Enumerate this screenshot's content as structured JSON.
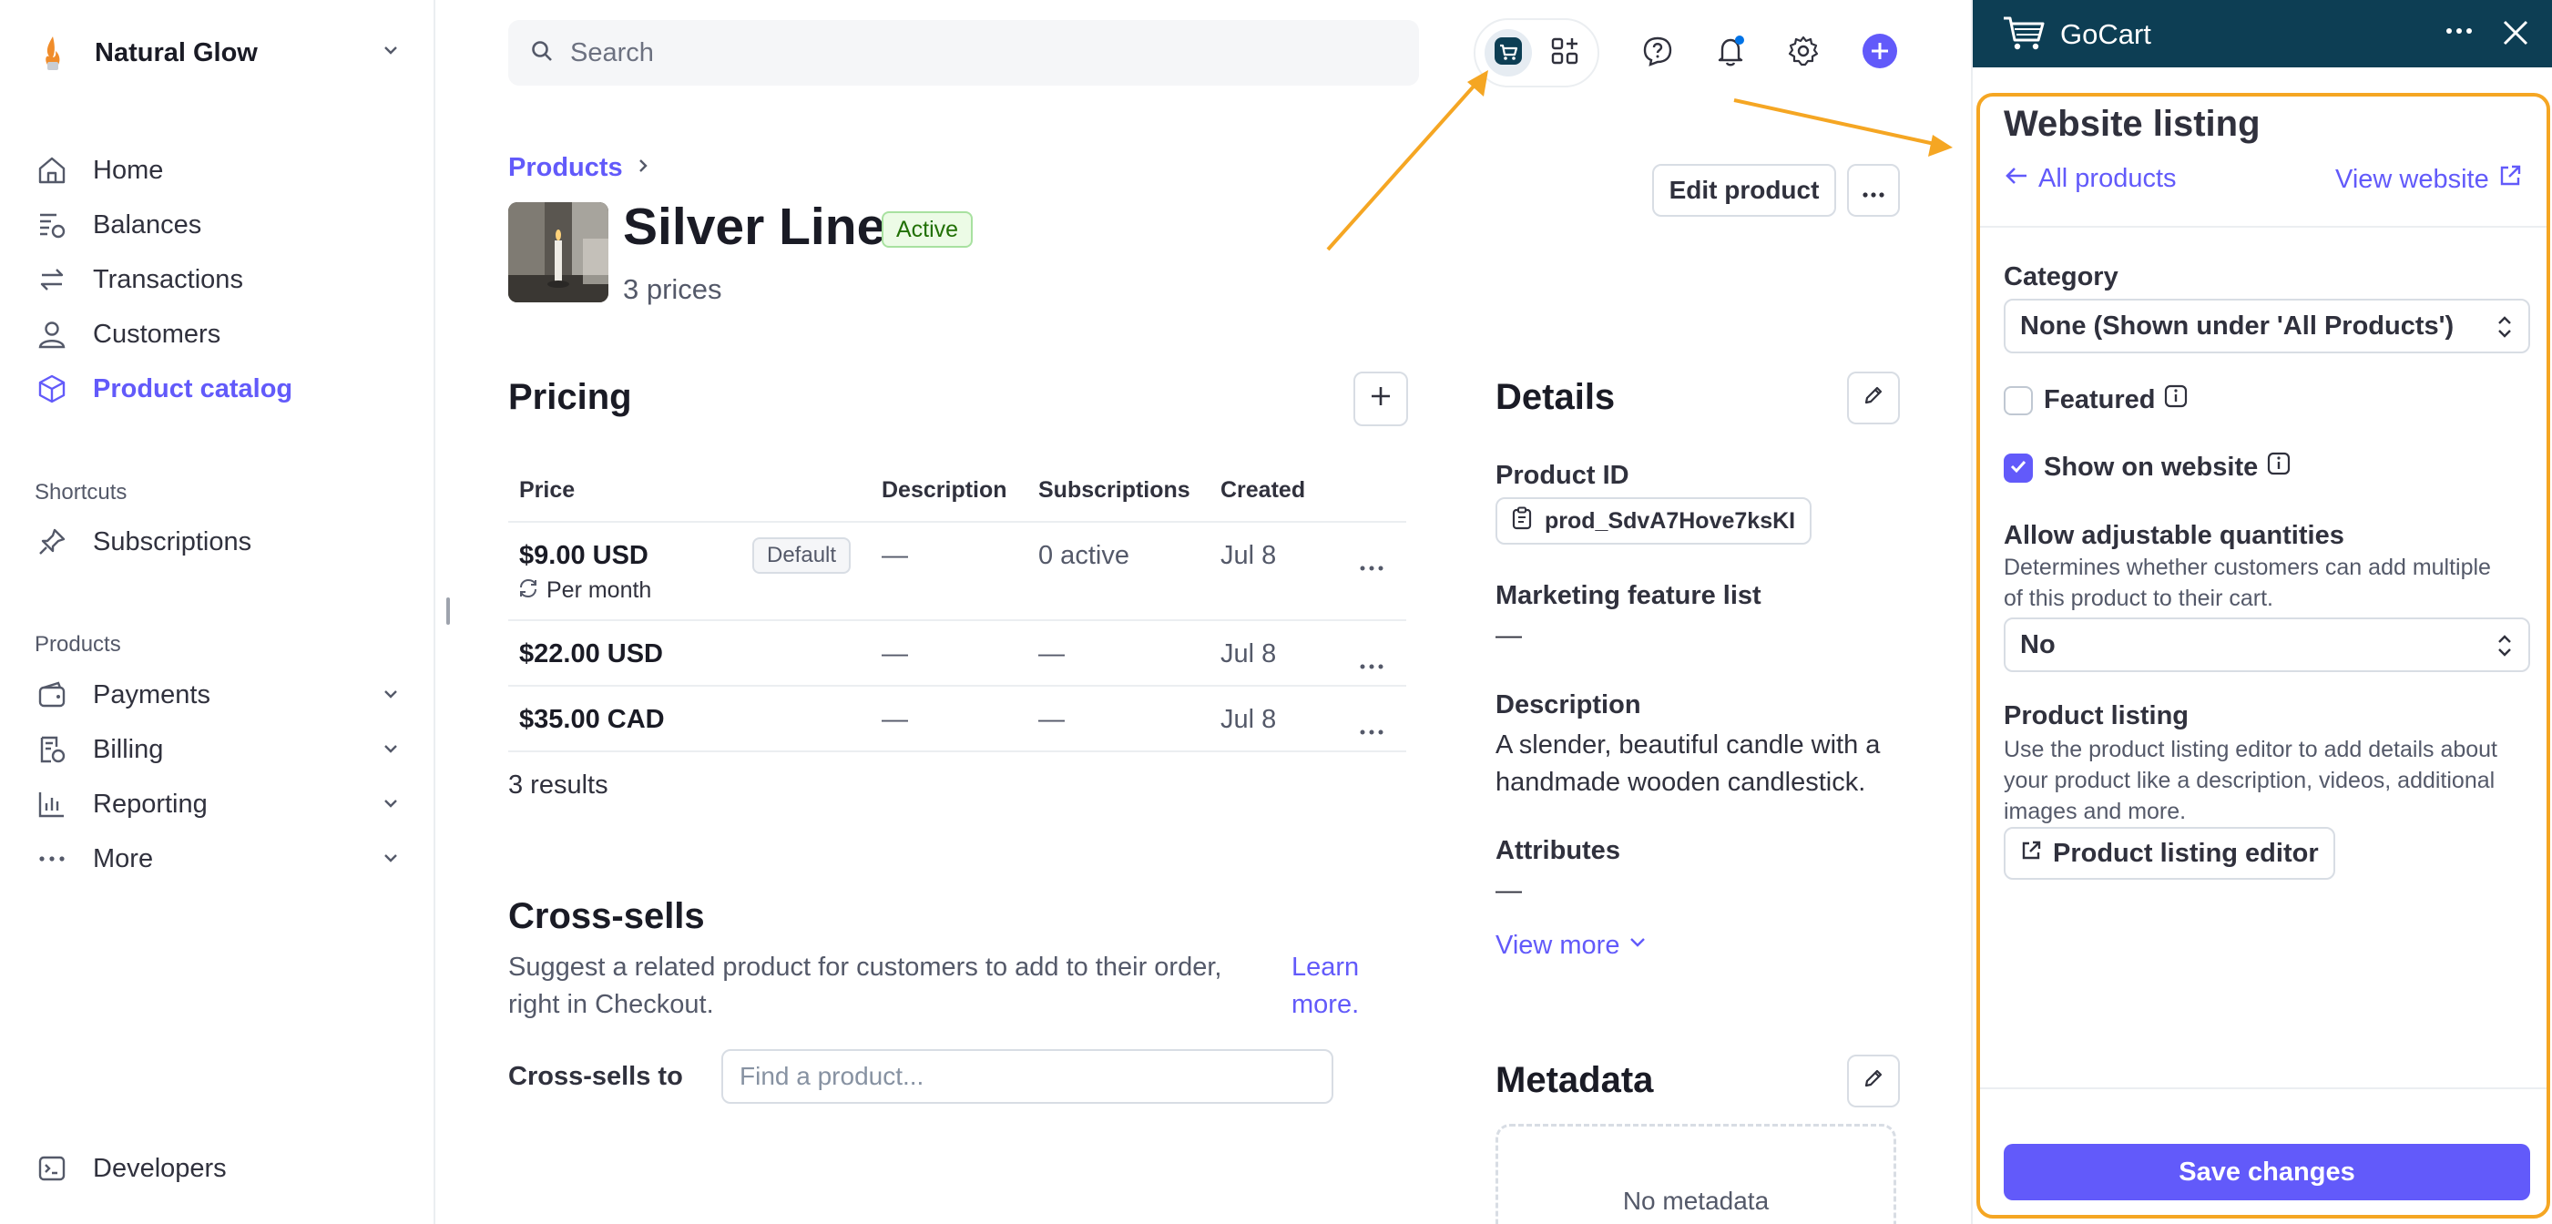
{
  "sidebar": {
    "account_name": "Natural Glow",
    "nav": [
      {
        "label": "Home",
        "icon": "home-icon"
      },
      {
        "label": "Balances",
        "icon": "balances-icon"
      },
      {
        "label": "Transactions",
        "icon": "transactions-icon"
      },
      {
        "label": "Customers",
        "icon": "customers-icon"
      },
      {
        "label": "Product catalog",
        "icon": "product-catalog-icon",
        "active": true
      }
    ],
    "shortcuts_label": "Shortcuts",
    "shortcuts": [
      {
        "label": "Subscriptions",
        "icon": "pin-icon"
      }
    ],
    "products_label": "Products",
    "products": [
      {
        "label": "Payments",
        "icon": "wallet-icon"
      },
      {
        "label": "Billing",
        "icon": "billing-icon"
      },
      {
        "label": "Reporting",
        "icon": "reporting-icon"
      },
      {
        "label": "More",
        "icon": "more-icon"
      }
    ],
    "developers_label": "Developers"
  },
  "topbar": {
    "search_placeholder": "Search",
    "icons": [
      "cart-app-icon",
      "apps-grid-icon",
      "help-icon",
      "bell-icon",
      "settings-icon",
      "create-plus-icon"
    ]
  },
  "product": {
    "breadcrumb": "Products",
    "name": "Silver Line",
    "status": "Active",
    "price_count": "3 prices",
    "edit_label": "Edit product"
  },
  "pricing": {
    "heading": "Pricing",
    "columns": [
      "Price",
      "Description",
      "Subscriptions",
      "Created"
    ],
    "rows": [
      {
        "price": "$9.00 USD",
        "badge": "Default",
        "interval": "Per month",
        "description": "—",
        "subscriptions": "0 active",
        "created": "Jul 8"
      },
      {
        "price": "$22.00 USD",
        "description": "—",
        "subscriptions": "—",
        "created": "Jul 8"
      },
      {
        "price": "$35.00 CAD",
        "description": "—",
        "subscriptions": "—",
        "created": "Jul 8"
      }
    ],
    "results": "3 results"
  },
  "cross_sells": {
    "heading": "Cross-sells",
    "description": "Suggest a related product for customers to add to their order, right in Checkout.",
    "learn_more_1": "Learn",
    "learn_more_2": "more.",
    "label": "Cross-sells to",
    "placeholder": "Find a product..."
  },
  "details": {
    "heading": "Details",
    "product_id_label": "Product ID",
    "product_id": "prod_SdvA7Hove7ksKI",
    "marketing_label": "Marketing feature list",
    "marketing_value": "—",
    "description_label": "Description",
    "description_line1": "A slender, beautiful candle with a",
    "description_line2": "handmade wooden candlestick.",
    "attributes_label": "Attributes",
    "attributes_value": "—",
    "view_more": "View more"
  },
  "metadata": {
    "heading": "Metadata",
    "empty": "No metadata"
  },
  "panel": {
    "app_name": "GoCart",
    "title": "Website listing",
    "back_link": "All products",
    "view_website": "View website",
    "category_label": "Category",
    "category_value": "None (Shown under 'All Products')",
    "featured_label": "Featured",
    "featured_checked": false,
    "show_label": "Show on website",
    "show_checked": true,
    "quantities_label": "Allow adjustable quantities",
    "quantities_help_1": "Determines whether customers can add multiple",
    "quantities_help_2": "of this product to their cart.",
    "quantities_value": "No",
    "listing_label": "Product listing",
    "listing_help_1": "Use the product listing editor to add details about",
    "listing_help_2": "your product like a description, videos, additional",
    "listing_help_3": "images and more.",
    "listing_button": "Product listing editor",
    "save_label": "Save changes"
  },
  "colors": {
    "accent": "#625afa",
    "panel_header": "#0d3e54",
    "annotation": "#f5a623",
    "active_badge_bg": "#ecfbe6",
    "active_badge_text": "#217005"
  }
}
